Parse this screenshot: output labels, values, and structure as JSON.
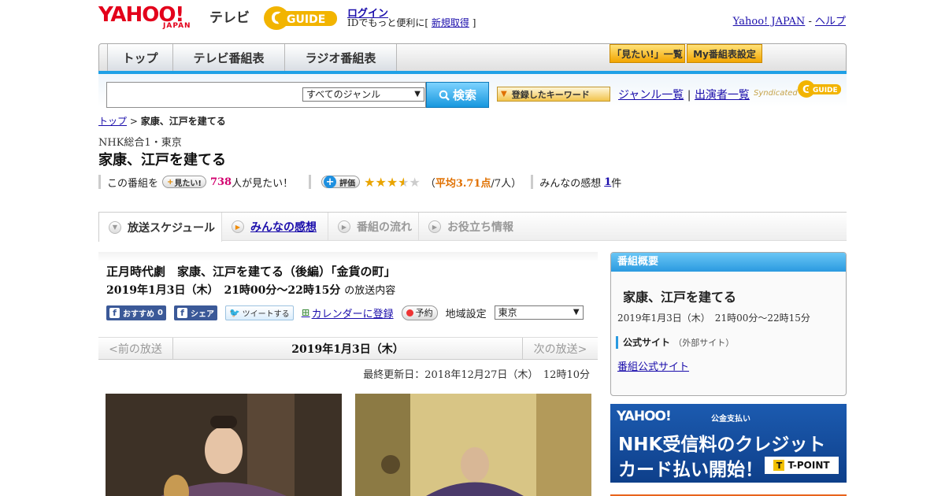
{
  "header": {
    "logo_text": "YAHOO!",
    "logo_sub": "JAPAN",
    "tv_label": "テレビ",
    "guide_logo": "G-GUIDE",
    "login_link": "ログイン",
    "login_prefix": "IDでもっと便利に[",
    "register_link": "新規取得",
    "login_suffix": "]",
    "yahoo_japan_link": "Yahoo! JAPAN",
    "separator": "-",
    "help_link": "ヘルプ"
  },
  "nav": {
    "tabs": [
      "トップ",
      "テレビ番組表",
      "ラジオ番組表"
    ],
    "mitai_list": "「見たい!」一覧",
    "my_schedule": "My番組表設定"
  },
  "search": {
    "input_value": "",
    "genre_selected": "すべてのジャンル",
    "search_button": "検索",
    "keyword_button": "登録したキーワード",
    "genre_link": "ジャンル一覧",
    "divider": "|",
    "performer_link": "出演者一覧",
    "syndicated": "Syndicated"
  },
  "breadcrumb": {
    "top": "トップ",
    "sep": ">",
    "current": "家康、江戸を建てる"
  },
  "program": {
    "station": "NHK総合1・東京",
    "title": "家康、江戸を建てる",
    "mitai_prefix": "この番組を",
    "mitai_button": "見たい!",
    "mitai_count": "738",
    "mitai_suffix": "人が見たい！",
    "hyoka_button": "評価",
    "rating_value": 3.71,
    "rating_open": "（",
    "rating_avg": "平均3.71点",
    "rating_count": "/7人）",
    "kanso_label": "みんなの感想",
    "kanso_count": "1",
    "kanso_unit": "件"
  },
  "tabs": {
    "schedule": "放送スケジュール",
    "kanso": "みんなの感想",
    "nagare": "番組の流れ",
    "yakudachi": "お役立ち情報"
  },
  "episode": {
    "title": "正月時代劇　家康、江戸を建てる（後編）「金貨の町」",
    "date": "2019年1月3日（木）　21時00分～22時15分",
    "date_suffix": "の放送内容",
    "fb_recommend": "おすすめ",
    "fb_count": "0",
    "fb_share": "シェア",
    "tweet": "ツイートする",
    "calendar": "カレンダーに登録",
    "yoyaku": "予約",
    "region_label": "地域設定",
    "region_value": "東京"
  },
  "pager": {
    "prev": "<前の放送",
    "date": "2019年1月3日（木）",
    "next": "次の放送>"
  },
  "updated": "最終更新日：2018年12月27日（木）　12時10分",
  "side": {
    "header": "番組概要",
    "title": "家康、江戸を建てる",
    "date": "2019年1月3日（木）　21時00分～22時15分",
    "official_label": "公式サイト",
    "official_sub": "（外部サイト）",
    "official_link": "番組公式サイト"
  },
  "banner": {
    "yahoo": "YAHOO!",
    "yahoo_sub": "JAPAN",
    "pay": "公金支払い",
    "line1": "NHK受信料のクレジット",
    "line2": "カード払い開始！",
    "tpoint": "T-POINT"
  },
  "colors": {
    "yahoo_red": "#e3001b",
    "accent_blue": "#1ea0e6",
    "link": "#1a0dab",
    "mitai_pink": "#d2006e",
    "star_gold": "#e9a400"
  }
}
